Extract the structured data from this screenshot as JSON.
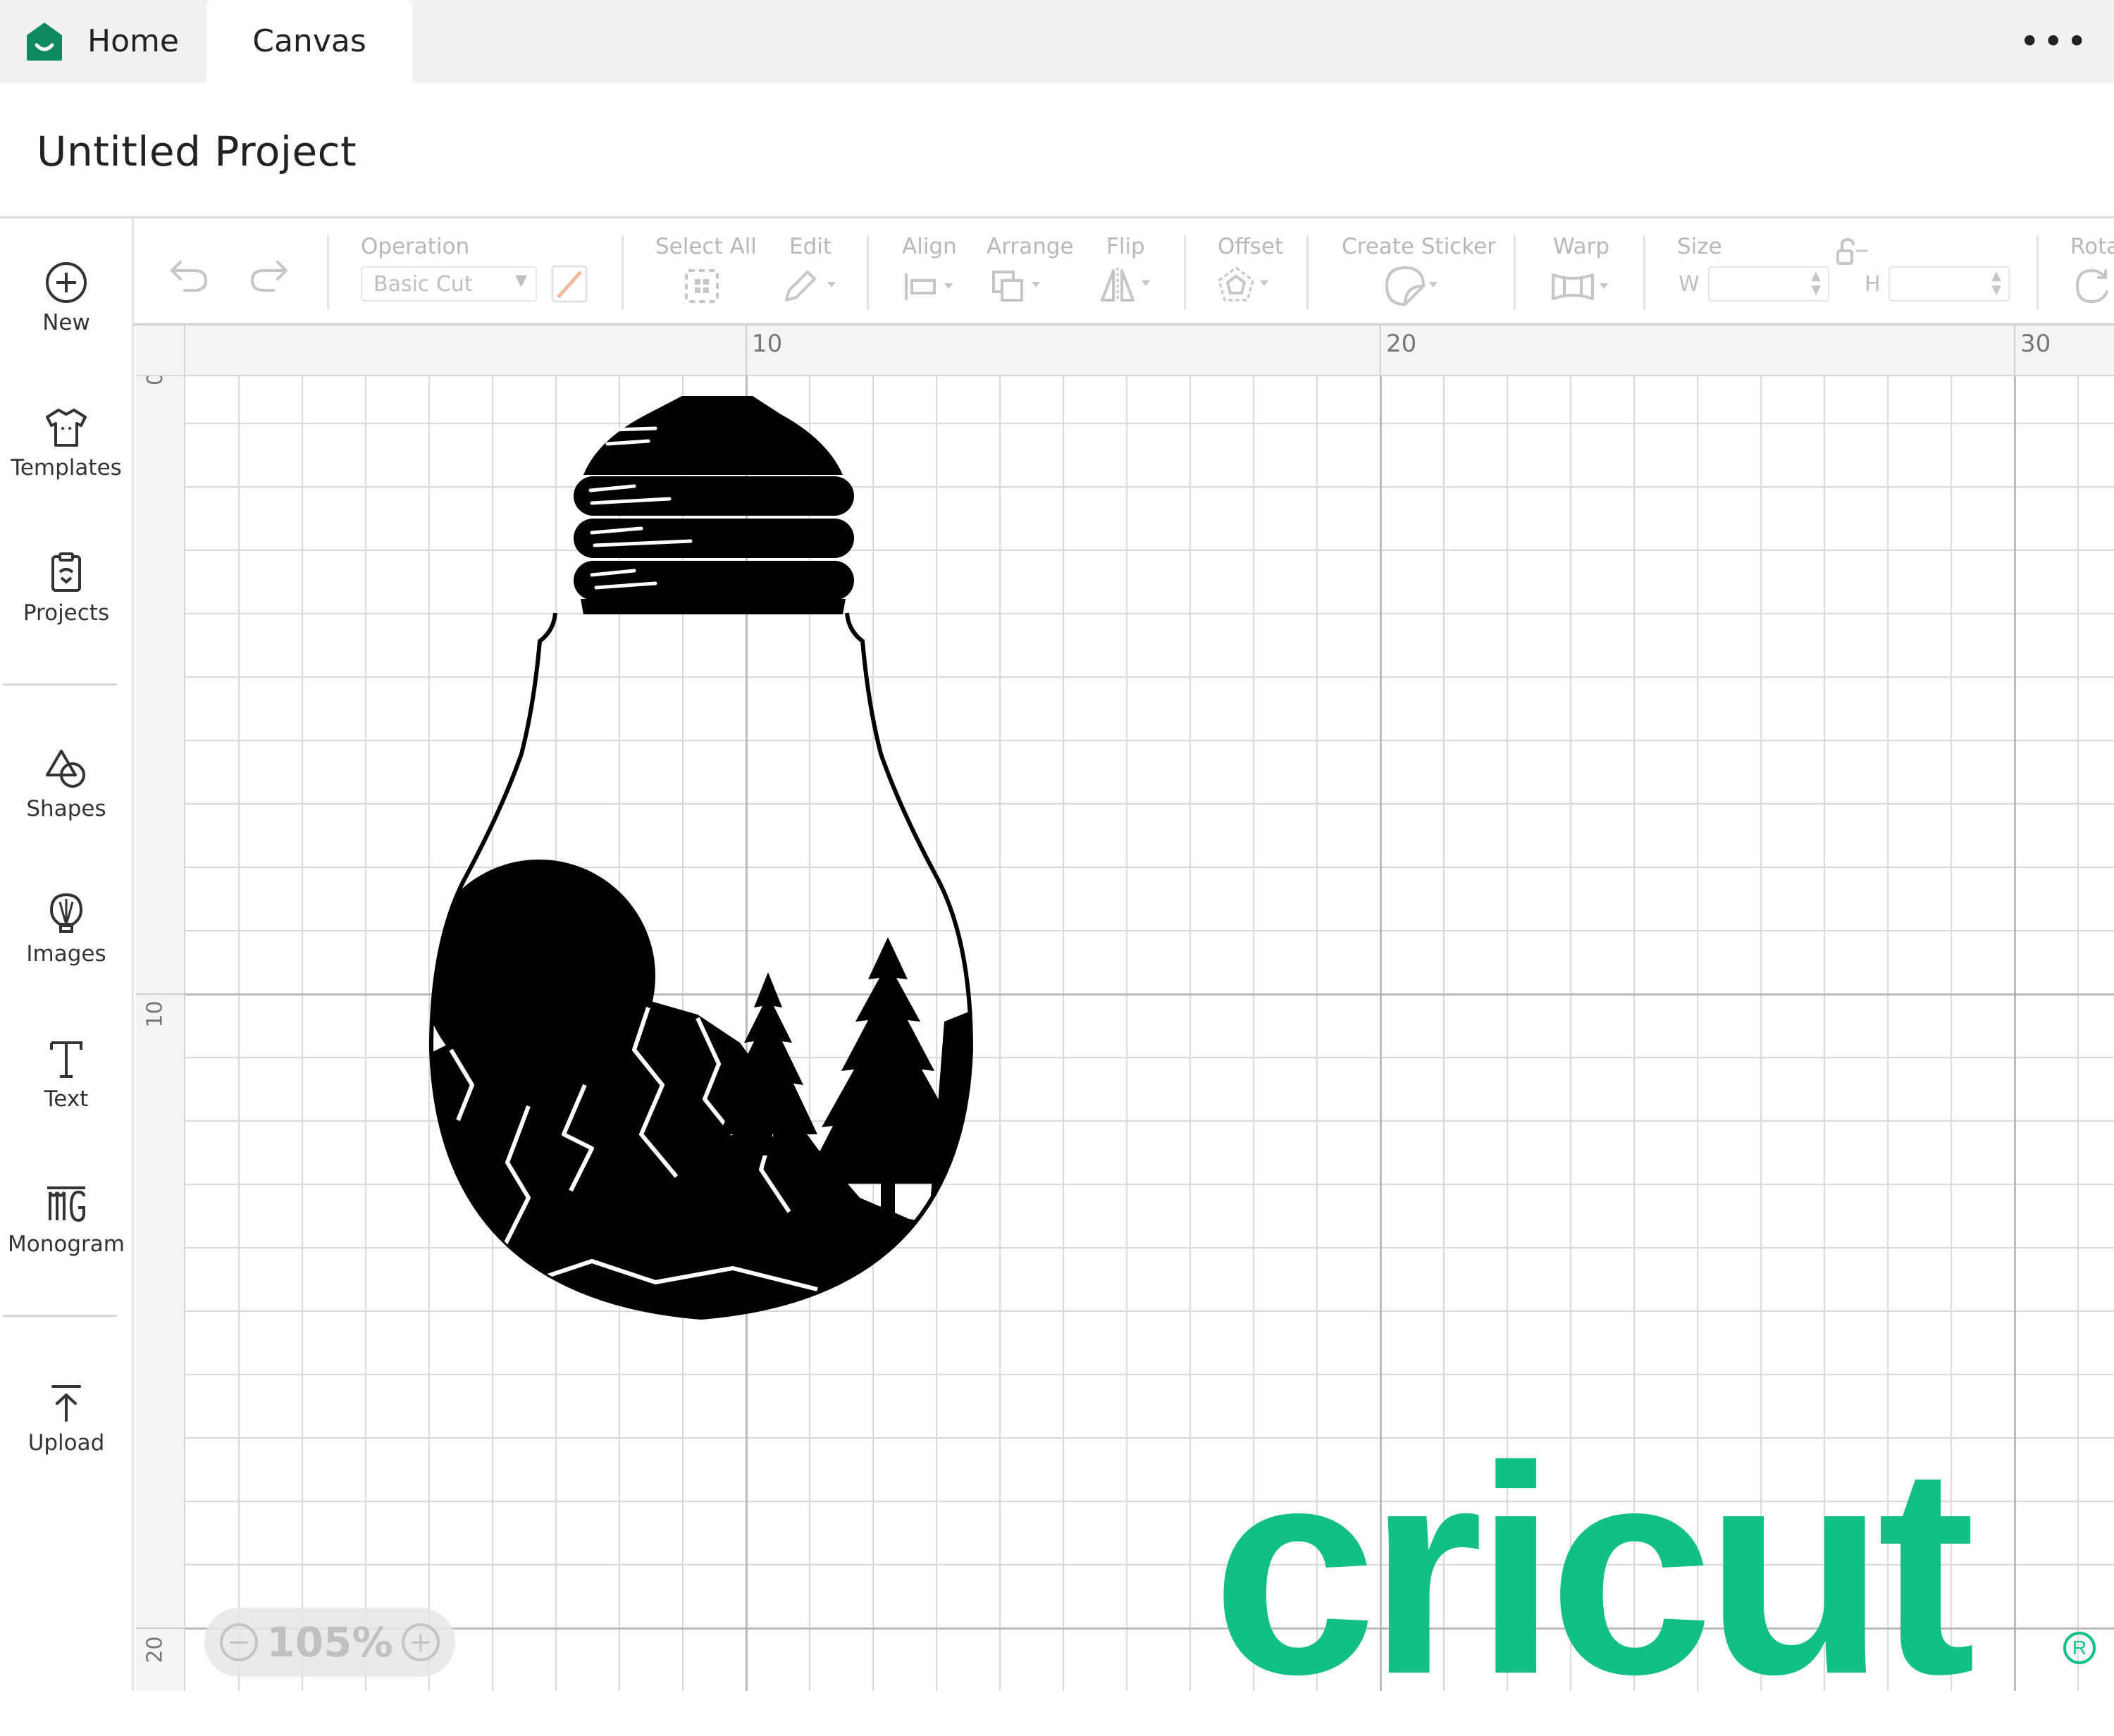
{
  "tabs": {
    "home": "Home",
    "canvas": "Canvas",
    "more": "•••"
  },
  "project": {
    "title": "Untitled Project"
  },
  "sidebar": {
    "items": [
      {
        "label": "New",
        "icon": "plus-circle-icon"
      },
      {
        "label": "Templates",
        "icon": "tshirt-icon"
      },
      {
        "label": "Projects",
        "icon": "projects-icon"
      },
      {
        "label": "Shapes",
        "icon": "shapes-icon"
      },
      {
        "label": "Images",
        "icon": "lightbulb-icon"
      },
      {
        "label": "Text",
        "icon": "text-icon"
      },
      {
        "label": "Monogram",
        "icon": "monogram-icon"
      },
      {
        "label": "Upload",
        "icon": "upload-icon"
      }
    ]
  },
  "toolbar": {
    "operation_label": "Operation",
    "operation_value": "Basic Cut",
    "select_all": "Select All",
    "edit": "Edit",
    "align": "Align",
    "arrange": "Arrange",
    "flip": "Flip",
    "offset": "Offset",
    "create_sticker": "Create Sticker",
    "warp": "Warp",
    "size": "Size",
    "w": "W",
    "h": "H",
    "rotate": "Rota"
  },
  "ruler": {
    "top": [
      "10",
      "20",
      "30"
    ],
    "left": [
      "0",
      "10",
      "20"
    ]
  },
  "zoom": {
    "value": "105%"
  },
  "brand": {
    "name": "cricut",
    "color": "#12bf84"
  }
}
